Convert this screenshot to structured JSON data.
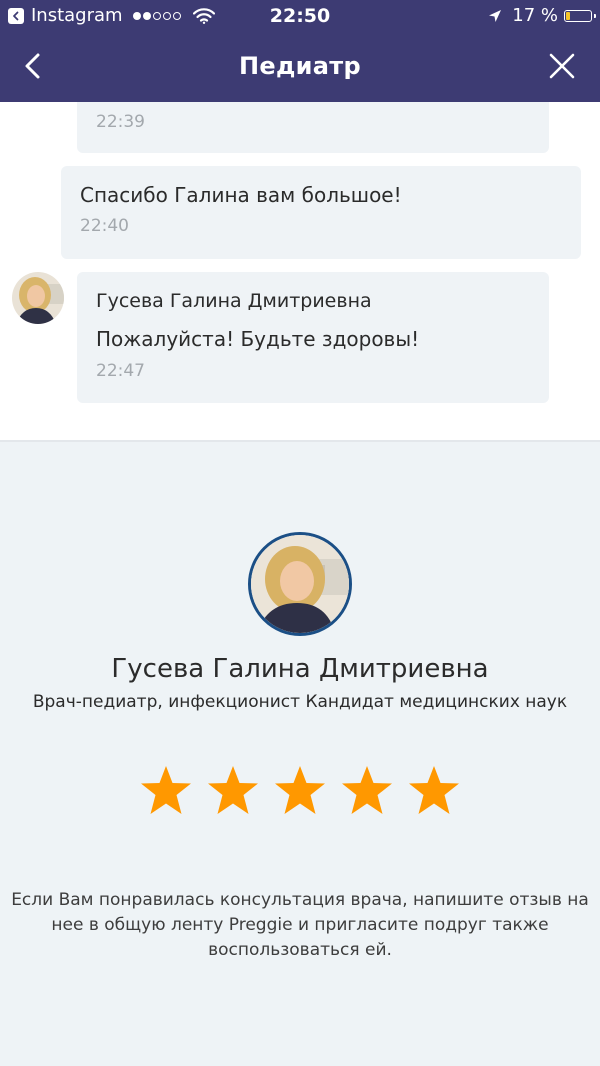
{
  "status_bar": {
    "app_back": "Instagram",
    "time": "22:50",
    "battery": "17 %",
    "battery_level": 0.17,
    "signal_bars": 2,
    "signal_total": 5
  },
  "navbar": {
    "title": "Педиатр",
    "back_icon": "chevron-left-icon",
    "close_icon": "close-icon"
  },
  "messages": [
    {
      "author": "",
      "text": "",
      "time": "22:39"
    },
    {
      "author": "",
      "text": "Спасибо Галина вам большое!",
      "time": "22:40"
    },
    {
      "author": "Гусева Галина Дмитриевна",
      "text": "Пожалуйста! Будьте здоровы!",
      "time": "22:47"
    }
  ],
  "doctor": {
    "name": "Гусева Галина Дмитриевна",
    "title": "Врач-педиатр, инфекционист Кандидат медицинских наук"
  },
  "rating": {
    "stars_filled": 5,
    "stars_total": 5,
    "star_color": "#ff9800"
  },
  "invite_text": "Если Вам понравилась консультация врача, напишите отзыв на нее в общую ленту Preggie и пригласите подруг также воспользоваться ей.",
  "colors": {
    "header": "#3d3b73",
    "bubble": "#eff3f6",
    "panel": "#eef3f6",
    "avatar_ring": "#1b4f86"
  }
}
